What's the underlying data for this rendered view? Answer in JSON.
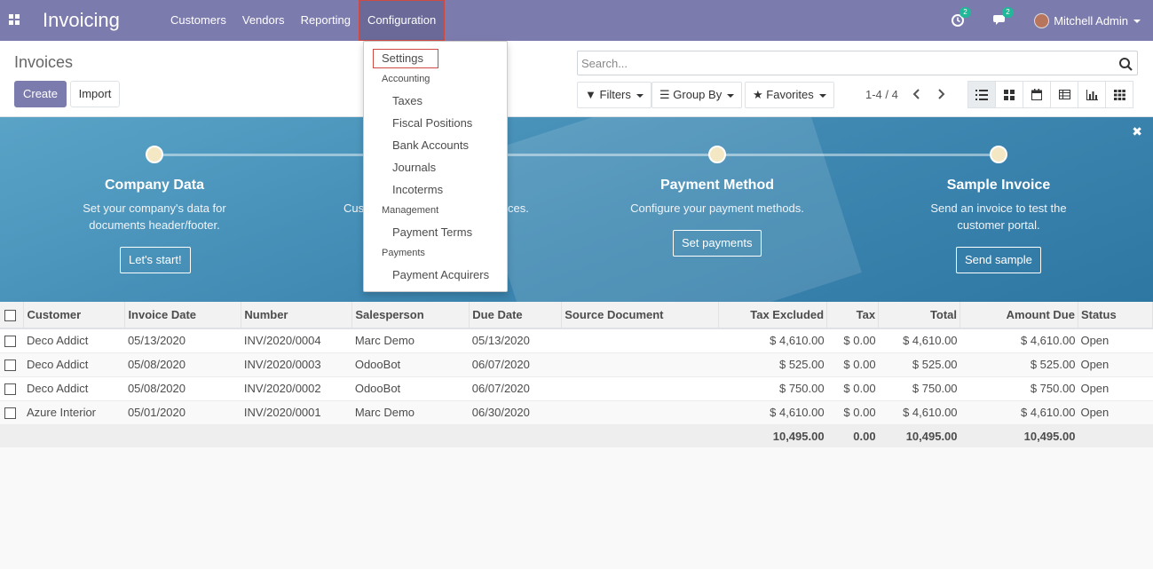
{
  "navbar": {
    "brand": "Invoicing",
    "menu": [
      "Customers",
      "Vendors",
      "Reporting",
      "Configuration"
    ],
    "activity_count": "2",
    "message_count": "2",
    "user": "Mitchell Admin"
  },
  "control": {
    "title": "Invoices",
    "create_label": "Create",
    "import_label": "Import",
    "search_placeholder": "Search...",
    "filters_label": "Filters",
    "groupby_label": "Group By",
    "favorites_label": "Favorites",
    "pager": "1-4 / 4"
  },
  "banner": {
    "steps": [
      {
        "title": "Company Data",
        "desc1": "Set your company's data for",
        "desc2": "documents header/footer.",
        "button": "Let's start!"
      },
      {
        "title": "",
        "desc1": "Cus",
        "desc2": "",
        "desc_right": "ces."
      },
      {
        "title": "Payment Method",
        "desc1": "Configure your payment methods.",
        "desc2": "",
        "button": "Set payments"
      },
      {
        "title": "Sample Invoice",
        "desc1": "Send an invoice to test the",
        "desc2": "customer portal.",
        "button": "Send sample"
      }
    ]
  },
  "table": {
    "columns": [
      "Customer",
      "Invoice Date",
      "Number",
      "Salesperson",
      "Due Date",
      "Source Document",
      "Tax Excluded",
      "Tax",
      "Total",
      "Amount Due",
      "Status"
    ],
    "rows": [
      {
        "customer": "Deco Addict",
        "invoice_date": "05/13/2020",
        "number": "INV/2020/0004",
        "salesperson": "Marc Demo",
        "due_date": "05/13/2020",
        "source": "",
        "tax_excluded": "$ 4,610.00",
        "tax": "$ 0.00",
        "total": "$ 4,610.00",
        "amount_due": "$ 4,610.00",
        "status": "Open"
      },
      {
        "customer": "Deco Addict",
        "invoice_date": "05/08/2020",
        "number": "INV/2020/0003",
        "salesperson": "OdooBot",
        "due_date": "06/07/2020",
        "source": "",
        "tax_excluded": "$ 525.00",
        "tax": "$ 0.00",
        "total": "$ 525.00",
        "amount_due": "$ 525.00",
        "status": "Open"
      },
      {
        "customer": "Deco Addict",
        "invoice_date": "05/08/2020",
        "number": "INV/2020/0002",
        "salesperson": "OdooBot",
        "due_date": "06/07/2020",
        "source": "",
        "tax_excluded": "$ 750.00",
        "tax": "$ 0.00",
        "total": "$ 750.00",
        "amount_due": "$ 750.00",
        "status": "Open"
      },
      {
        "customer": "Azure Interior",
        "invoice_date": "05/01/2020",
        "number": "INV/2020/0001",
        "salesperson": "Marc Demo",
        "due_date": "06/30/2020",
        "source": "",
        "tax_excluded": "$ 4,610.00",
        "tax": "$ 0.00",
        "total": "$ 4,610.00",
        "amount_due": "$ 4,610.00",
        "status": "Open"
      }
    ],
    "totals": {
      "tax_excluded": "10,495.00",
      "tax": "0.00",
      "total": "10,495.00",
      "amount_due": "10,495.00"
    }
  },
  "dropdown": {
    "settings": "Settings",
    "accounting_header": "Accounting",
    "accounting_items": [
      "Taxes",
      "Fiscal Positions",
      "Bank Accounts",
      "Journals",
      "Incoterms"
    ],
    "management_header": "Management",
    "management_items": [
      "Payment Terms"
    ],
    "payments_header": "Payments",
    "payments_items": [
      "Payment Acquirers"
    ]
  },
  "colors": {
    "navbar": "#7c7bad",
    "banner": "#3f89b3",
    "highlight_border": "#d04a44",
    "badge": "#21b799"
  }
}
